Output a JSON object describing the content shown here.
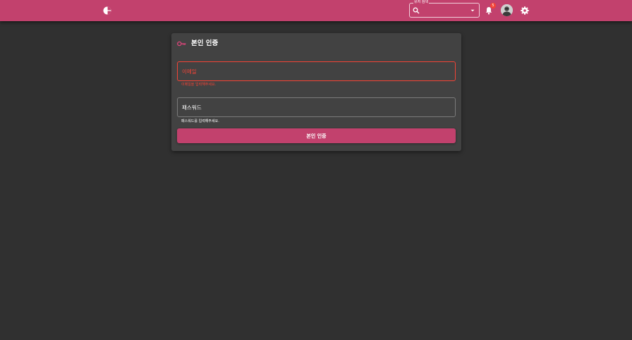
{
  "colors": {
    "topbar": "#c2416d",
    "background": "#303030",
    "card": "#424242",
    "error": "#f44336",
    "accent": "#c2416d"
  },
  "topbar": {
    "logo_icon": "pie-chart-logo",
    "search": {
      "legend": "유저 검색",
      "value": "",
      "icon": "search-icon"
    },
    "notifications": {
      "icon": "bell-icon",
      "count": "5"
    },
    "avatar_icon": "user-avatar",
    "settings_icon": "gear-icon"
  },
  "card": {
    "icon": "key-icon",
    "title": "본인 인증",
    "email": {
      "placeholder": "이메일",
      "helper": "이메일을 입력해주세요."
    },
    "password": {
      "placeholder": "패스워드",
      "helper": "패스워드를 입력해주세요."
    },
    "submit_label": "본인 인증"
  }
}
